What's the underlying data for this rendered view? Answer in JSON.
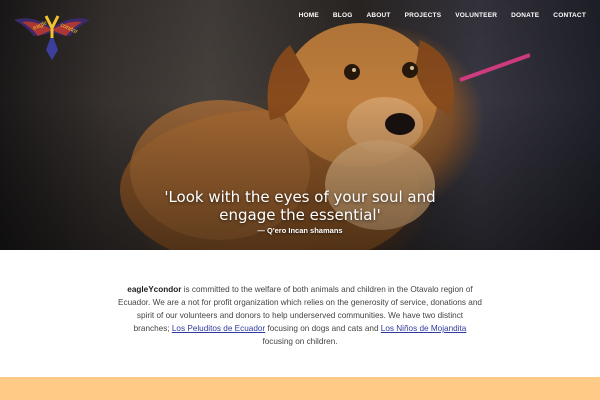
{
  "nav": {
    "items": [
      {
        "label": "HOME"
      },
      {
        "label": "BLOG"
      },
      {
        "label": "ABOUT"
      },
      {
        "label": "PROJECTS"
      },
      {
        "label": "VOLUNTEER"
      },
      {
        "label": "DONATE"
      },
      {
        "label": "CONTACT"
      }
    ]
  },
  "logo": {
    "left_word": "eagle",
    "center_letter": "Y",
    "right_word": "condor"
  },
  "hero": {
    "quote_line_1": "'Look with the eyes of your soul and",
    "quote_line_2": "engage the essential'",
    "attribution": "— Q'ero Incan shamans"
  },
  "intro": {
    "brand": "eagleYcondor",
    "text_1": " is committed to the welfare of both animals and children in the Otavalo region of Ecuador. We are a not for profit organization which relies on the generosity of service, donations and spirit of our volunteers and donors to help underserved communities. We have two distinct branches; ",
    "link_1": "Los Peluditos de Ecuador",
    "text_2": " focusing on dogs and cats and ",
    "link_2": "Los Niños de Mojandita",
    "text_3": " focusing on children."
  },
  "colors": {
    "accent_band": "#fdcb86",
    "link": "#2f3b9c",
    "leash": "#e0408a"
  }
}
